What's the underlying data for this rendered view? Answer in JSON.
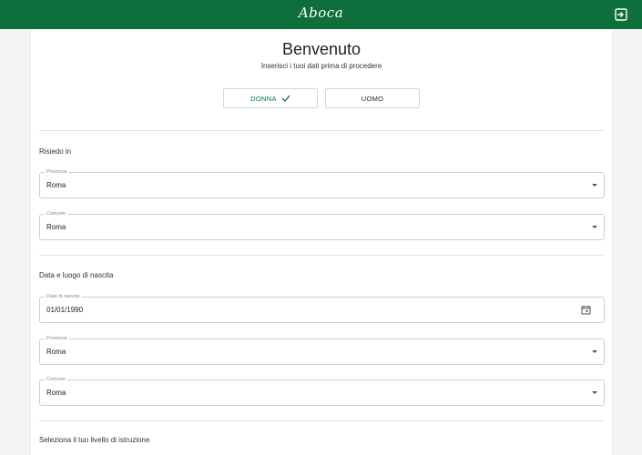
{
  "header": {
    "logo_text": "Aboca",
    "background_color": "#0f6f3c",
    "logout_icon": "logout-icon"
  },
  "welcome": {
    "title": "Benvenuto",
    "subtitle": "Inserisci i tuoi dati prima di procedere"
  },
  "gender": {
    "female_label": "DONNA",
    "male_label": "UOMO",
    "selected": "DONNA"
  },
  "residence": {
    "section_label": "Risiedo in",
    "provincia": {
      "label": "Provincia",
      "value": "Roma"
    },
    "comune": {
      "label": "Comune",
      "value": "Roma"
    }
  },
  "birth": {
    "section_label": "Data e luogo di nascita",
    "date": {
      "label": "Data di nascita",
      "value": "01/01/1990"
    },
    "provincia": {
      "label": "Provincia",
      "value": "Roma"
    },
    "comune": {
      "label": "Comune",
      "value": "Roma"
    }
  },
  "education": {
    "section_label": "Seleziona il tuo livello di istruzione"
  }
}
